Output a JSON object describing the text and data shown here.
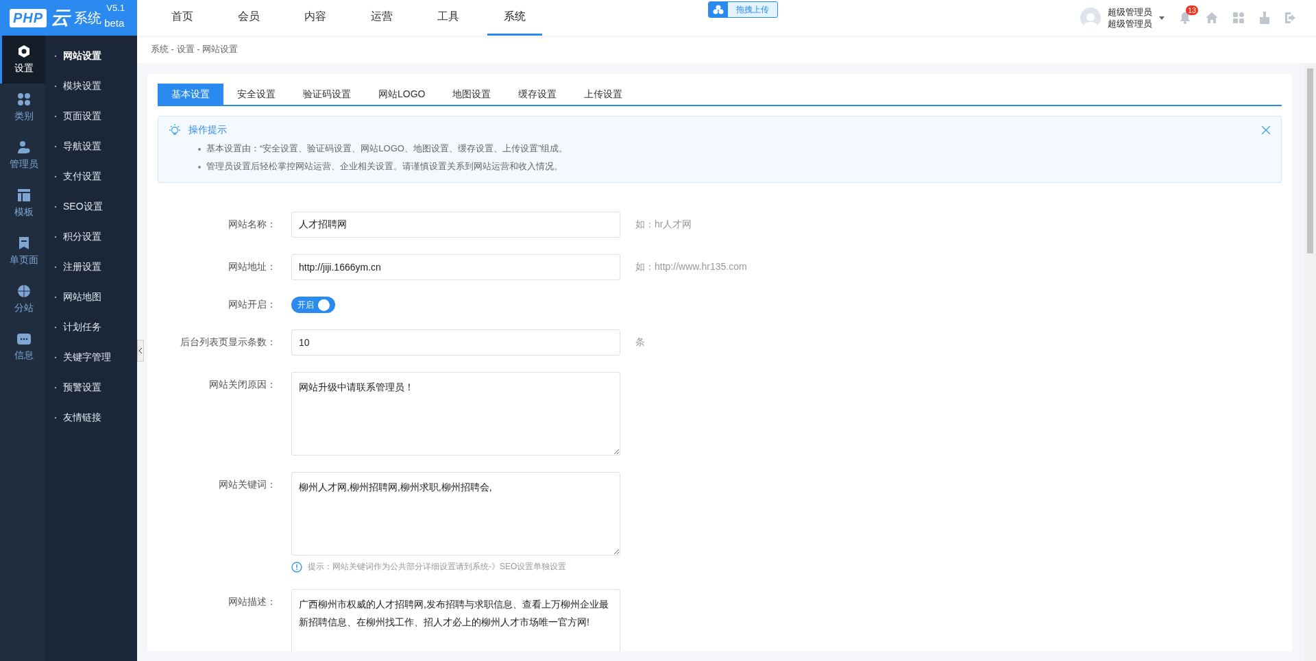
{
  "logo": {
    "brand": "PHP",
    "cloud": "云",
    "name": "系统",
    "edition": "beta",
    "version": "V5.1"
  },
  "nav": [
    {
      "label": "首页",
      "selected": false
    },
    {
      "label": "会员",
      "selected": false
    },
    {
      "label": "内容",
      "selected": false
    },
    {
      "label": "运营",
      "selected": false
    },
    {
      "label": "工具",
      "selected": false
    },
    {
      "label": "系统",
      "selected": true
    }
  ],
  "upload": {
    "label": "拖拽上传"
  },
  "user": {
    "name": "超级管理员",
    "role": "超级管理员"
  },
  "notifications": {
    "count": "13"
  },
  "sidebar": [
    {
      "kind": "gear",
      "label": "设置",
      "selected": true
    },
    {
      "kind": "category",
      "label": "类别",
      "selected": false
    },
    {
      "kind": "admin",
      "label": "管理员",
      "selected": false
    },
    {
      "kind": "template",
      "label": "模板",
      "selected": false
    },
    {
      "kind": "page",
      "label": "单页面",
      "selected": false
    },
    {
      "kind": "www",
      "label": "分站",
      "selected": false
    },
    {
      "kind": "message",
      "label": "信息",
      "selected": false
    }
  ],
  "submenu": [
    {
      "label": "网站设置",
      "selected": true
    },
    {
      "label": "模块设置",
      "selected": false
    },
    {
      "label": "页面设置",
      "selected": false
    },
    {
      "label": "导航设置",
      "selected": false
    },
    {
      "label": "支付设置",
      "selected": false
    },
    {
      "label": "SEO设置",
      "selected": false
    },
    {
      "label": "积分设置",
      "selected": false
    },
    {
      "label": "注册设置",
      "selected": false
    },
    {
      "label": "网站地图",
      "selected": false
    },
    {
      "label": "计划任务",
      "selected": false
    },
    {
      "label": "关键字管理",
      "selected": false
    },
    {
      "label": "预警设置",
      "selected": false
    },
    {
      "label": "友情链接",
      "selected": false
    }
  ],
  "breadcrumb": "系统 - 设置 - 网站设置",
  "tabs": [
    {
      "label": "基本设置",
      "selected": true
    },
    {
      "label": "安全设置",
      "selected": false
    },
    {
      "label": "验证码设置",
      "selected": false
    },
    {
      "label": "网站LOGO",
      "selected": false
    },
    {
      "label": "地图设置",
      "selected": false
    },
    {
      "label": "缓存设置",
      "selected": false
    },
    {
      "label": "上传设置",
      "selected": false
    }
  ],
  "tips": {
    "title": "操作提示",
    "items": [
      "基本设置由：“安全设置、验证码设置、网站LOGO、地图设置、缓存设置、上传设置”组成。",
      "管理员设置后轻松掌控网站运营、企业相关设置。请谨慎设置关系到网站运营和收入情况。"
    ]
  },
  "form": [
    {
      "kind": "text",
      "label": "网站名称：",
      "value": "人才招聘网",
      "note": "如：hr人才网"
    },
    {
      "kind": "text",
      "label": "网站地址：",
      "value": "http://jiji.1666ym.cn",
      "note": "如：http://www.hr135.com"
    },
    {
      "kind": "toggle",
      "label": "网站开启：",
      "on": true,
      "value": "开启"
    },
    {
      "kind": "text",
      "label": "后台列表页显示条数：",
      "value": "10",
      "note": "条"
    },
    {
      "kind": "textarea",
      "label": "网站关闭原因：",
      "value": "网站升级中请联系管理员！"
    },
    {
      "kind": "textarea",
      "label": "网站关键词：",
      "value": "柳州人才网,柳州招聘网,柳州求职,柳州招聘会,",
      "hint": "提示：网站关键词作为公共部分详细设置请到系统-》SEO设置单独设置"
    },
    {
      "kind": "textarea",
      "label": "网站描述：",
      "value": "广西柳州市权威的人才招聘网,发布招聘与求职信息、查看上万柳州企业最新招聘信息、在柳州找工作、招人才必上的柳州人才市场唯一官方网!"
    }
  ]
}
